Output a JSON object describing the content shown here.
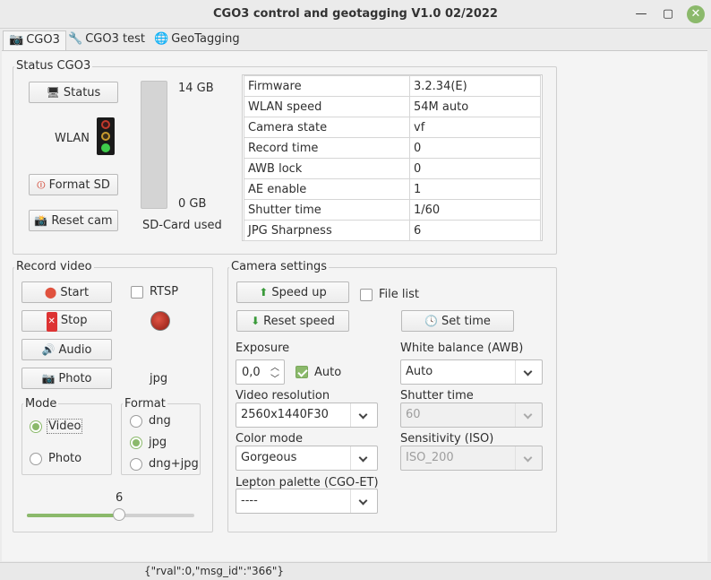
{
  "window": {
    "title": "CGO3 control and geotagging  V1.0 02/2022",
    "minimize_glyph": "—",
    "maximize_glyph": "▢",
    "close_glyph": "✕"
  },
  "tabs": [
    {
      "label": "CGO3",
      "icon": "camera-icon",
      "active": true
    },
    {
      "label": "CGO3 test",
      "icon": "tools-icon",
      "active": false
    },
    {
      "label": "GeoTagging",
      "icon": "globe-icon",
      "active": false
    }
  ],
  "status": {
    "group_label": "Status CGO3",
    "status_button": "Status",
    "wlan_label": "WLAN",
    "format_button": "Format SD",
    "reset_button": "Reset cam",
    "sd_top": "14 GB",
    "sd_bottom": "0 GB",
    "sd_caption": "SD-Card used",
    "sd_used_fraction": 0,
    "properties": [
      {
        "key": "Firmware",
        "value": "3.2.34(E)"
      },
      {
        "key": "WLAN speed",
        "value": "54M auto"
      },
      {
        "key": "Camera state",
        "value": "vf"
      },
      {
        "key": "Record time",
        "value": "0"
      },
      {
        "key": "AWB lock",
        "value": "0"
      },
      {
        "key": "AE enable",
        "value": "1"
      },
      {
        "key": "Shutter time",
        "value": "1/60"
      },
      {
        "key": "JPG Sharpness",
        "value": "6"
      }
    ]
  },
  "record": {
    "group_label": "Record video",
    "start_button": "Start",
    "stop_button": "Stop",
    "audio_button": "Audio",
    "photo_button": "Photo",
    "rtsp_label": "RTSP",
    "rtsp_checked": false,
    "photo_format_display": "jpg",
    "mode_label": "Mode",
    "mode_options": [
      "Video",
      "Photo"
    ],
    "mode_selected": "Video",
    "format_label": "Format",
    "format_options": [
      "dng",
      "jpg",
      "dng+jpg"
    ],
    "format_selected": "jpg",
    "slider_value": "6",
    "slider_fraction": 0.55
  },
  "camera": {
    "group_label": "Camera settings",
    "speed_up_button": "Speed up",
    "reset_speed_button": "Reset speed",
    "file_list_label": "File list",
    "file_list_checked": false,
    "set_time_button": "Set time",
    "exposure_label": "Exposure",
    "exposure_value": "0,0",
    "auto_label": "Auto",
    "auto_checked": true,
    "video_res_label": "Video resolution",
    "video_res_value": "2560x1440F30",
    "color_mode_label": "Color mode",
    "color_mode_value": "Gorgeous",
    "lepton_label": "Lepton palette (CGO-ET)",
    "lepton_value": "----",
    "wb_label": "White balance (AWB)",
    "wb_value": "Auto",
    "shutter_label": "Shutter time",
    "shutter_value": "60",
    "iso_label": "Sensitivity (ISO)",
    "iso_value": "ISO_200"
  },
  "statusbar": {
    "message": "{\"rval\":0,\"msg_id\":\"366\"}"
  },
  "colors": {
    "accent": "#8bb96b",
    "record_red": "#c0392b",
    "sd_bar": "#d4d4d4"
  }
}
